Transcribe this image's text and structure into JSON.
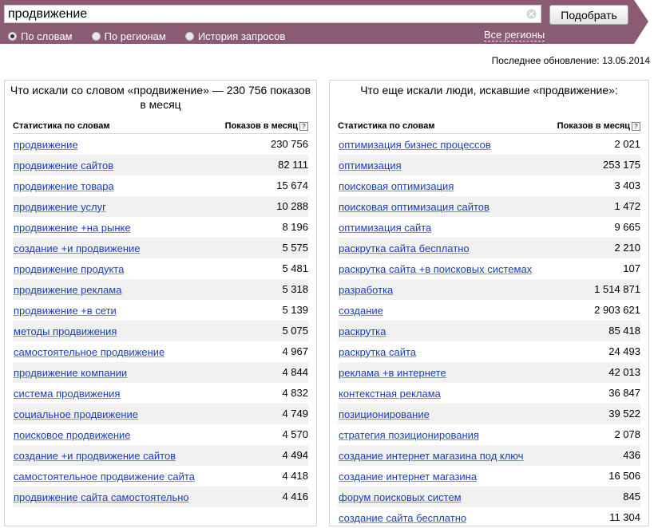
{
  "search": {
    "query": "продвижение",
    "button_label": "Подобрать"
  },
  "modes": [
    {
      "label": "По словам",
      "checked": true
    },
    {
      "label": "По регионам",
      "checked": false
    },
    {
      "label": "История запросов",
      "checked": false
    }
  ],
  "regions_link": "Все регионы",
  "last_update": "Последнее обновление: 13.05.2014",
  "colors": {
    "header_bg": "#8b5b73",
    "link": "#1a3dc1",
    "row_alt": "#f1f1f1"
  },
  "left_panel": {
    "title": "Что искали со словом «продвижение» — 230 756 показов в месяц",
    "col_phrase": "Статистика по словам",
    "col_count": "Показов в месяц",
    "help_icon": "?",
    "rows": [
      {
        "phrase": "продвижение",
        "count": "230 756"
      },
      {
        "phrase": "продвижение сайтов",
        "count": "82 111"
      },
      {
        "phrase": "продвижение товара",
        "count": "15 674"
      },
      {
        "phrase": "продвижение услуг",
        "count": "10 288"
      },
      {
        "phrase": "продвижение +на рынке",
        "count": "8 196"
      },
      {
        "phrase": "создание +и продвижение",
        "count": "5 575"
      },
      {
        "phrase": "продвижение продукта",
        "count": "5 481"
      },
      {
        "phrase": "продвижение реклама",
        "count": "5 318"
      },
      {
        "phrase": "продвижение +в сети",
        "count": "5 139"
      },
      {
        "phrase": "методы продвижения",
        "count": "5 075"
      },
      {
        "phrase": "самостоятельное продвижение",
        "count": "4 967"
      },
      {
        "phrase": "продвижение компании",
        "count": "4 844"
      },
      {
        "phrase": "система продвижения",
        "count": "4 832"
      },
      {
        "phrase": "социальное продвижение",
        "count": "4 749"
      },
      {
        "phrase": "поисковое продвижение",
        "count": "4 570"
      },
      {
        "phrase": "создание +и продвижение сайтов",
        "count": "4 494"
      },
      {
        "phrase": "самостоятельное продвижение сайта",
        "count": "4 418"
      },
      {
        "phrase": "продвижение сайта самостоятельно",
        "count": "4 416"
      }
    ]
  },
  "right_panel": {
    "title": "Что еще искали люди, искавшие «продвижение»:",
    "col_phrase": "Статистика по словам",
    "col_count": "Показов в месяц",
    "help_icon": "?",
    "rows": [
      {
        "phrase": "оптимизация бизнес процессов",
        "count": "2 021"
      },
      {
        "phrase": "оптимизация",
        "count": "253 175"
      },
      {
        "phrase": "поисковая оптимизация",
        "count": "3 403"
      },
      {
        "phrase": "поисковая оптимизация сайтов",
        "count": "1 472"
      },
      {
        "phrase": "оптимизация сайта",
        "count": "9 665"
      },
      {
        "phrase": "раскрутка сайта бесплатно",
        "count": "2 210"
      },
      {
        "phrase": "раскрутка сайта +в поисковых системах",
        "count": "107"
      },
      {
        "phrase": "разработка",
        "count": "1 514 871"
      },
      {
        "phrase": "создание",
        "count": "2 903 621"
      },
      {
        "phrase": "раскрутка",
        "count": "85 418"
      },
      {
        "phrase": "раскрутка сайта",
        "count": "24 493"
      },
      {
        "phrase": "реклама +в интернете",
        "count": "42 013"
      },
      {
        "phrase": "контекстная реклама",
        "count": "36 847"
      },
      {
        "phrase": "позиционирование",
        "count": "39 522"
      },
      {
        "phrase": "стратегия позиционирования",
        "count": "2 078"
      },
      {
        "phrase": "создание интернет магазина под ключ",
        "count": "436"
      },
      {
        "phrase": "создание интернет магазина",
        "count": "16 506"
      },
      {
        "phrase": "форум поисковых систем",
        "count": "845"
      },
      {
        "phrase": "создание сайта бесплатно",
        "count": "11 304"
      }
    ]
  }
}
